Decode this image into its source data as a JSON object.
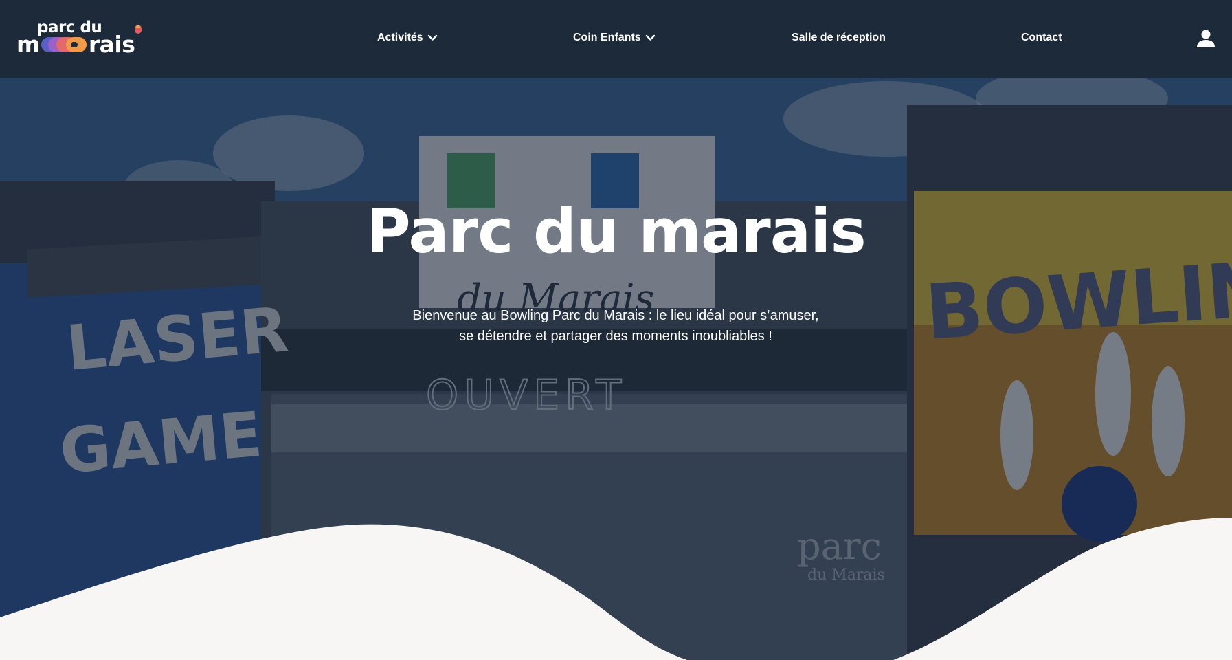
{
  "brand": {
    "logo_top": "parc du",
    "logo_bottom_start": "m",
    "logo_bottom_end": "rais"
  },
  "nav": {
    "items": [
      {
        "label": "Activités",
        "has_dropdown": true
      },
      {
        "label": "Coin Enfants",
        "has_dropdown": true
      },
      {
        "label": "Salle de réception",
        "has_dropdown": false
      },
      {
        "label": "Contact",
        "has_dropdown": false
      }
    ],
    "account_icon": "user-icon"
  },
  "hero": {
    "title": "Parc du marais",
    "subtitle": "Bienvenue au Bowling Parc du Marais : le lieu idéal pour s’amuser, se détendre et partager des moments inoubliables !",
    "background_signs": {
      "left": "LASER GAME",
      "center": "OUVERT",
      "right": "BOWLING",
      "building_logo": "parc du Marais"
    }
  },
  "colors": {
    "header_bg": "#1d2a39",
    "wave_fill": "#f8f6f4",
    "text": "#ffffff"
  }
}
